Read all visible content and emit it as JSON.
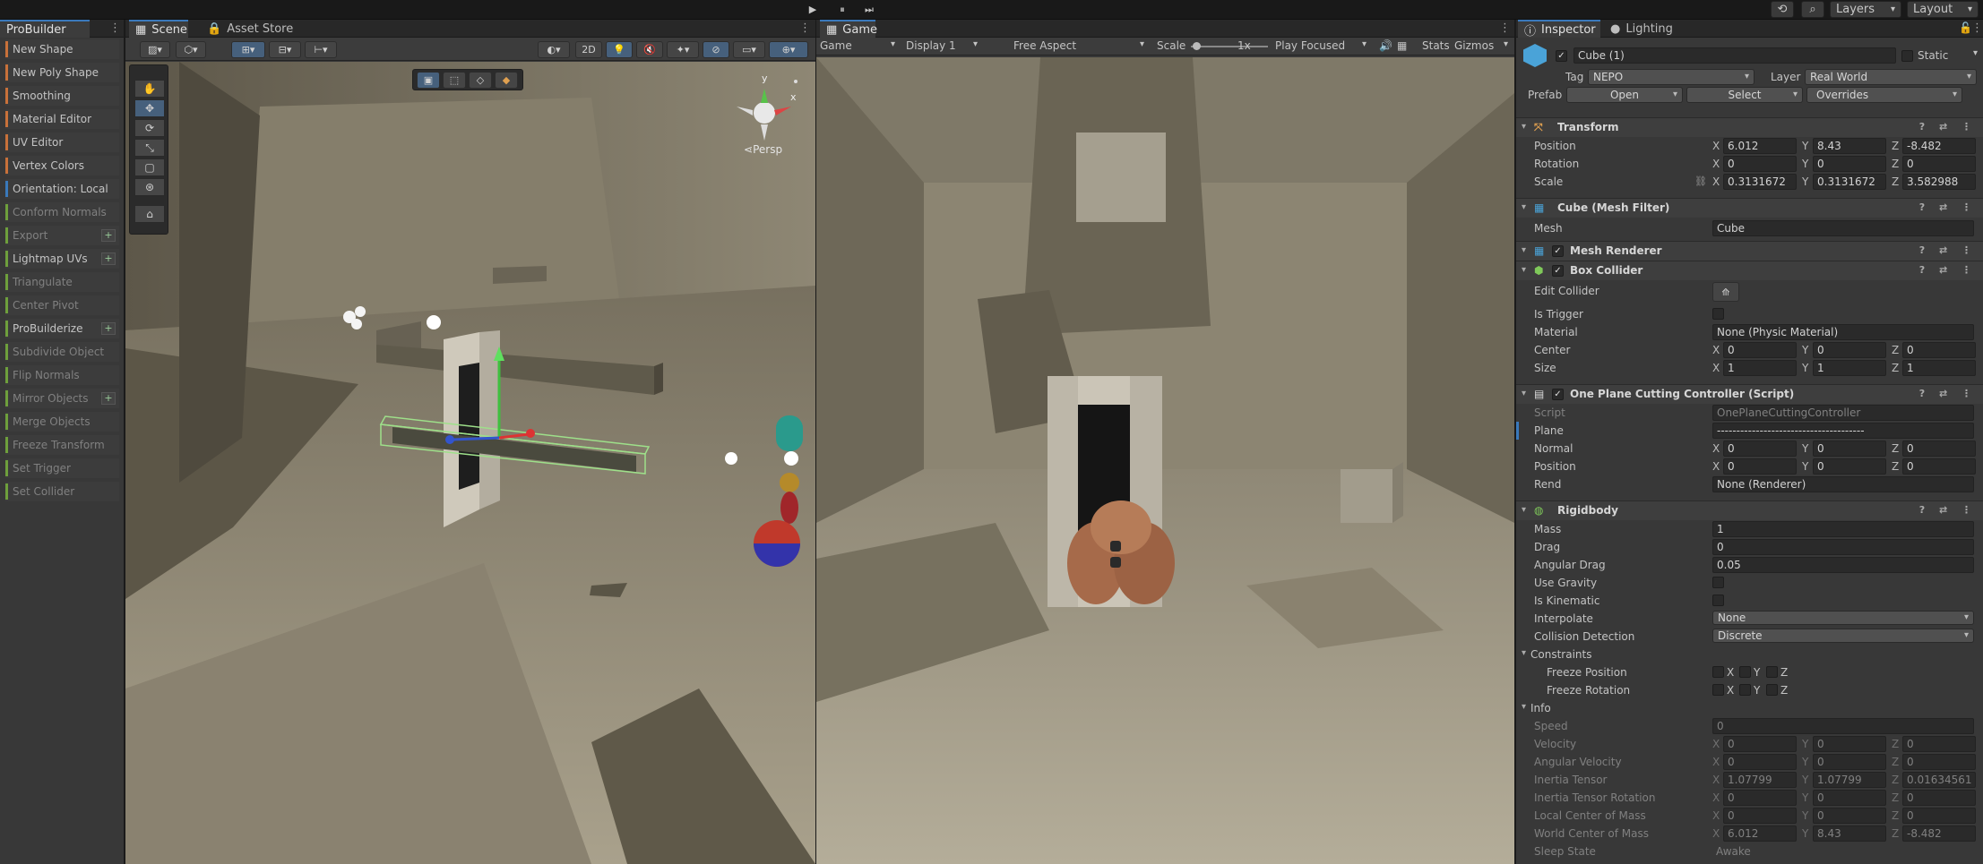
{
  "toolbar": {
    "play": "▶",
    "pause": "⏸",
    "step": "⏭",
    "history": "⟲",
    "search": "⌕",
    "layers": "Layers",
    "layout": "Layout"
  },
  "probuilder": {
    "tab": "ProBuilder",
    "items": [
      {
        "label": "New Shape",
        "color": "#c8713a",
        "dim": false
      },
      {
        "label": "New Poly Shape",
        "color": "#c8713a",
        "dim": false
      },
      {
        "label": "Smoothing",
        "color": "#c8713a",
        "dim": false
      },
      {
        "label": "Material Editor",
        "color": "#c8713a",
        "dim": false
      },
      {
        "label": "UV Editor",
        "color": "#c8713a",
        "dim": false
      },
      {
        "label": "Vertex Colors",
        "color": "#c8713a",
        "dim": false
      },
      {
        "label": "Orientation: Local",
        "color": "#3a79bb",
        "dim": false
      },
      {
        "label": "Conform Normals",
        "color": "#6e9f3c",
        "dim": true
      },
      {
        "label": "Export",
        "color": "#6e9f3c",
        "dim": true,
        "plus": true
      },
      {
        "label": "Lightmap UVs",
        "color": "#6e9f3c",
        "dim": false,
        "plus": true
      },
      {
        "label": "Triangulate",
        "color": "#6e9f3c",
        "dim": true
      },
      {
        "label": "Center Pivot",
        "color": "#6e9f3c",
        "dim": true
      },
      {
        "label": "ProBuilderize",
        "color": "#6e9f3c",
        "dim": false,
        "plus": true
      },
      {
        "label": "Subdivide Object",
        "color": "#6e9f3c",
        "dim": true
      },
      {
        "label": "Flip Normals",
        "color": "#6e9f3c",
        "dim": true
      },
      {
        "label": "Mirror Objects",
        "color": "#6e9f3c",
        "dim": true,
        "plus": true
      },
      {
        "label": "Merge Objects",
        "color": "#6e9f3c",
        "dim": true
      },
      {
        "label": "Freeze Transform",
        "color": "#6e9f3c",
        "dim": true
      },
      {
        "label": "Set Trigger",
        "color": "#6e9f3c",
        "dim": true
      },
      {
        "label": "Set Collider",
        "color": "#6e9f3c",
        "dim": true
      }
    ]
  },
  "scene": {
    "tab_scene": "Scene",
    "tab_store": "Asset Store",
    "btn_2d": "2D",
    "persp": "Persp",
    "gizmo_y": "y",
    "gizmo_x": "x"
  },
  "game": {
    "tab": "Game",
    "mode": "Game",
    "display": "Display 1",
    "aspect": "Free Aspect",
    "scale_label": "Scale",
    "scale_value": "1x",
    "play_focused": "Play Focused",
    "stats": "Stats",
    "gizmos": "Gizmos"
  },
  "inspector": {
    "tab_inspector": "Inspector",
    "tab_lighting": "Lighting",
    "object_name": "Cube (1)",
    "static": "Static",
    "tag_label": "Tag",
    "tag": "NEPO",
    "layer_label": "Layer",
    "layer": "Real World",
    "prefab_label": "Prefab",
    "open": "Open",
    "select": "Select",
    "overrides": "Overrides",
    "transform": {
      "title": "Transform",
      "position_label": "Position",
      "rotation_label": "Rotation",
      "scale_label": "Scale",
      "position": [
        "6.012",
        "8.43",
        "-8.482"
      ],
      "rotation": [
        "0",
        "0",
        "0"
      ],
      "scale": [
        "0.3131672",
        "0.3131672",
        "3.582988"
      ]
    },
    "meshfilter": {
      "title": "Cube (Mesh Filter)",
      "mesh_label": "Mesh",
      "mesh": "Cube"
    },
    "meshrenderer": {
      "title": "Mesh Renderer"
    },
    "boxcollider": {
      "title": "Box Collider",
      "edit_label": "Edit Collider",
      "trigger_label": "Is Trigger",
      "material_label": "Material",
      "material": "None (Physic Material)",
      "center_label": "Center",
      "center": [
        "0",
        "0",
        "0"
      ],
      "size_label": "Size",
      "size": [
        "1",
        "1",
        "1"
      ]
    },
    "script": {
      "title": "One Plane Cutting Controller (Script)",
      "script_label": "Script",
      "script": "OnePlaneCuttingController",
      "plane_label": "Plane",
      "plane": "--------------------------------------",
      "normal_label": "Normal",
      "normal": [
        "0",
        "0",
        "0"
      ],
      "position_label": "Position",
      "position": [
        "0",
        "0",
        "0"
      ],
      "rend_label": "Rend",
      "rend": "None (Renderer)"
    },
    "rigidbody": {
      "title": "Rigidbody",
      "mass_label": "Mass",
      "mass": "1",
      "drag_label": "Drag",
      "drag": "0",
      "adrag_label": "Angular Drag",
      "adrag": "0.05",
      "gravity_label": "Use Gravity",
      "kinematic_label": "Is Kinematic",
      "interp_label": "Interpolate",
      "interp": "None",
      "coll_label": "Collision Detection",
      "coll": "Discrete",
      "constraints": "Constraints",
      "freeze_pos": "Freeze Position",
      "freeze_rot": "Freeze Rotation",
      "info": "Info",
      "speed_label": "Speed",
      "speed": "0",
      "velocity_label": "Velocity",
      "velocity": [
        "0",
        "0",
        "0"
      ],
      "angvel_label": "Angular Velocity",
      "angvel": [
        "0",
        "0",
        "0"
      ],
      "itensor_label": "Inertia Tensor",
      "itensor": [
        "1.07799",
        "1.07799",
        "0.01634561"
      ],
      "itrot_label": "Inertia Tensor Rotation",
      "itrot": [
        "0",
        "0",
        "0"
      ],
      "lcom_label": "Local Center of Mass",
      "lcom": [
        "0",
        "0",
        "0"
      ],
      "wcom_label": "World Center of Mass",
      "wcom": [
        "6.012",
        "8.43",
        "-8.482"
      ],
      "sleep_label": "Sleep State",
      "sleep": "Awake"
    },
    "axes": {
      "x": "X",
      "y": "Y",
      "z": "Z"
    }
  }
}
